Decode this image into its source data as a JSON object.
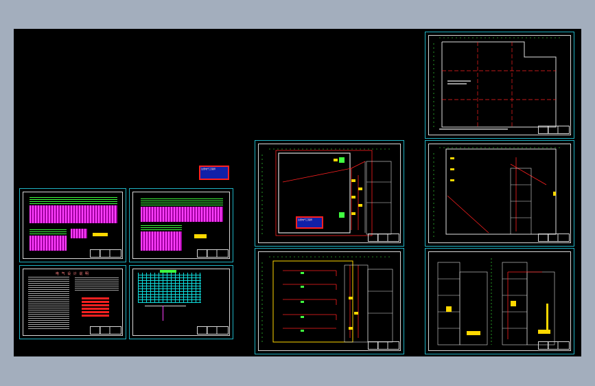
{
  "viewer": {
    "background_color": "#a3aebd",
    "canvas_color": "#000000",
    "frame_color": "#1fb3c4"
  },
  "sheets": [
    {
      "id": "electrical-system-1"
    },
    {
      "id": "electrical-system-2"
    },
    {
      "id": "design-notes",
      "title": "电 气 设 计 说 明"
    },
    {
      "id": "equipment-schedule"
    },
    {
      "id": "ground-floor-power-plan"
    },
    {
      "id": "ground-floor-lighting-plan"
    },
    {
      "id": "roof-plan"
    },
    {
      "id": "upper-floor-plan"
    },
    {
      "id": "section-details"
    }
  ],
  "stamps": [
    {
      "id": "floating-stamp",
      "text": "注册电气工程师"
    },
    {
      "id": "plan-stamp",
      "text": "注册电气工程师"
    }
  ]
}
